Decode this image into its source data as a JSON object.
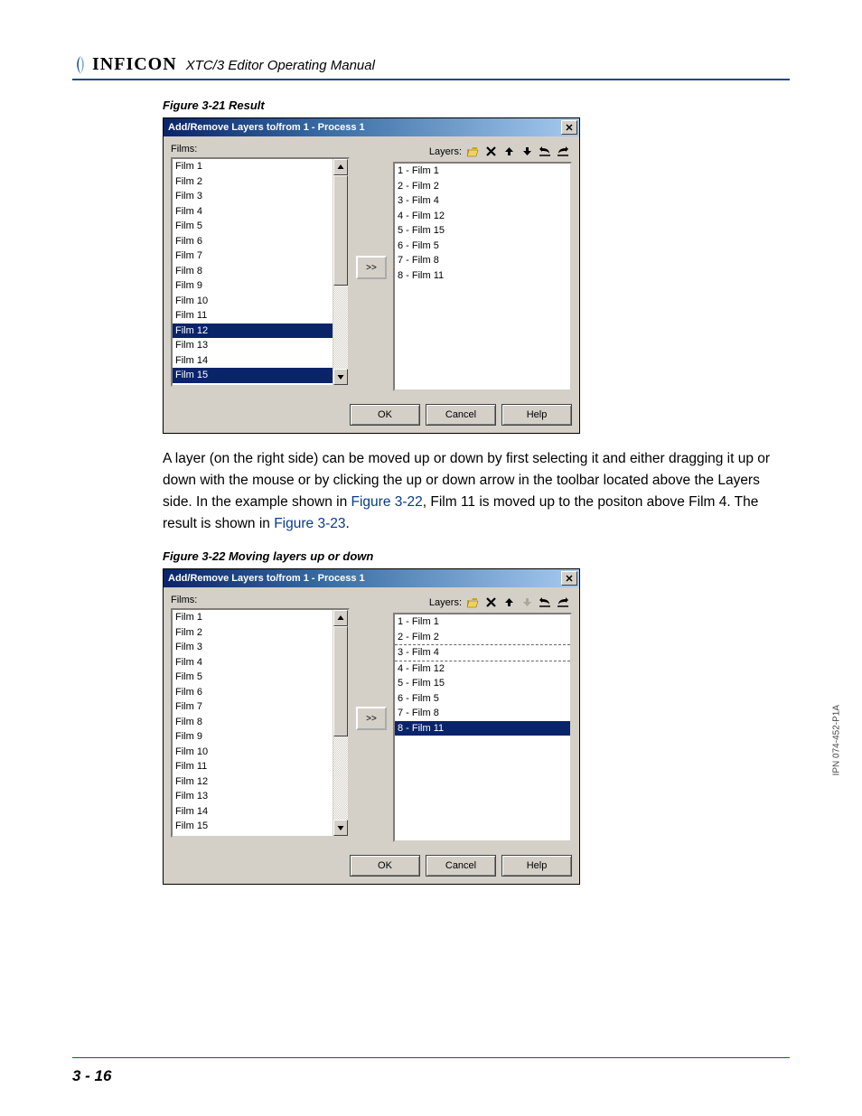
{
  "header": {
    "brand": "INFICON",
    "manual": "XTC/3 Editor Operating Manual"
  },
  "fig1": {
    "caption": "Figure 3-21  Result",
    "title": "Add/Remove Layers to/from 1 - Process 1",
    "films_label": "Films:",
    "layers_label": "Layers:",
    "films": [
      "Film 1",
      "Film 2",
      "Film 3",
      "Film 4",
      "Film 5",
      "Film 6",
      "Film 7",
      "Film 8",
      "Film 9",
      "Film 10",
      "Film 11",
      "Film 12",
      "Film 13",
      "Film 14",
      "Film 15"
    ],
    "films_selected": [
      11,
      14
    ],
    "layers": [
      "1 - Film 1",
      "2 - Film 2",
      "3 - Film 4",
      "4 - Film 12",
      "5 - Film 15",
      "6 - Film 5",
      "7 - Film 8",
      "8 - Film 11"
    ],
    "layers_selected": [],
    "layers_drag": -1,
    "move_btn": ">>",
    "ok": "OK",
    "cancel": "Cancel",
    "help": "Help",
    "toolbar_disabled": []
  },
  "para": {
    "t1": "A layer (on the right side) can be moved up or down by first selecting it and either dragging it up or down with the mouse or by clicking the up or down arrow in the toolbar located above the Layers side. In the example shown in ",
    "x1": "Figure 3-22",
    "t2": ", Film 11 is moved up to the positon above Film 4. The result is shown in ",
    "x2": "Figure 3-23",
    "t3": "."
  },
  "fig2": {
    "caption": "Figure 3-22  Moving layers up or down",
    "title": "Add/Remove Layers to/from 1 - Process 1",
    "films_label": "Films:",
    "layers_label": "Layers:",
    "films": [
      "Film 1",
      "Film 2",
      "Film 3",
      "Film 4",
      "Film 5",
      "Film 6",
      "Film 7",
      "Film 8",
      "Film 9",
      "Film 10",
      "Film 11",
      "Film 12",
      "Film 13",
      "Film 14",
      "Film 15"
    ],
    "films_selected": [],
    "layers": [
      "1 - Film 1",
      "2 - Film 2",
      "3 - Film 4",
      "4 - Film 12",
      "5 - Film 15",
      "6 - Film 5",
      "7 - Film 8",
      "8 - Film 11"
    ],
    "layers_selected": [
      7
    ],
    "layers_drag": 2,
    "move_btn": ">>",
    "ok": "OK",
    "cancel": "Cancel",
    "help": "Help",
    "toolbar_disabled": [
      3
    ]
  },
  "footer": {
    "page": "3 - 16",
    "side": "IPN 074-452-P1A"
  }
}
